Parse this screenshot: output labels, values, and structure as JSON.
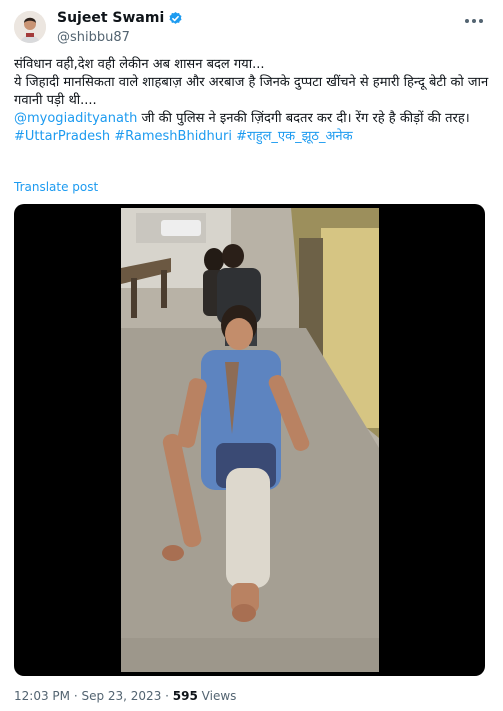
{
  "author": {
    "display_name": "Sujeet Swami",
    "handle": "@shibbu87",
    "verified": true,
    "avatar_icon": "avatar-photo"
  },
  "menu_icon": "more-horizontal-icon",
  "post": {
    "line1": "संविधान वही,देश वही लेकीन अब शासन बदल गया...",
    "line2": "ये जिहादी मानसिकता वाले शाहबाज़ और अरबाज  है जिनके दुप्पटा खींचने से हमारी हिन्दू बेटी को जान गवानी पड़ी थी....",
    "mention": "@myogiadityanath",
    "line3": " जी की पुलिस ने इनकी ज़िंदगी बदतर कर दी। रेंग रहे है कीड़ों की तरह।",
    "hashtags": [
      "#UttarPradesh",
      "#RameshBhidhuri",
      "#राहुल_एक_झूठ_अनेक"
    ],
    "translate_label": "Translate post"
  },
  "media": {
    "type": "video"
  },
  "meta": {
    "time": "12:03 PM",
    "separator": " · ",
    "date": "Sep 23, 2023",
    "views_count": "595",
    "views_label": " Views"
  },
  "colors": {
    "link": "#1d9bf0",
    "secondary": "#536471",
    "text": "#0f1419"
  }
}
